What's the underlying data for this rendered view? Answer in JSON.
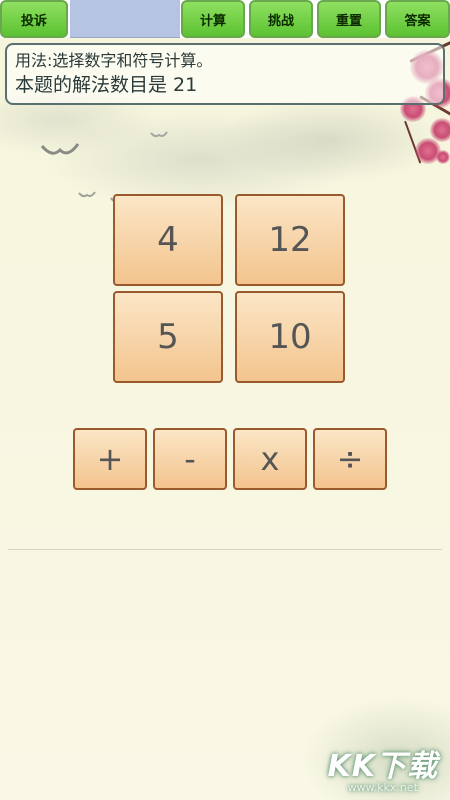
{
  "toolbar": {
    "complain_label": "投诉",
    "calculate_label": "计算",
    "challenge_label": "挑战",
    "reset_label": "重置",
    "answer_label": "答案"
  },
  "info": {
    "usage_text": "用法:选择数字和符号计算。",
    "solutions_text": "本题的解法数目是 21"
  },
  "numbers": [
    "4",
    "12",
    "5",
    "10"
  ],
  "operators": [
    "+",
    "-",
    "x",
    "÷"
  ],
  "watermark": {
    "logo_text": "KK下载",
    "url_text": "www.kkx.net"
  },
  "colors": {
    "toolbar_button": "#5cc232",
    "tile_fill": "#f3c48e",
    "tile_border": "#9a5a2e"
  }
}
